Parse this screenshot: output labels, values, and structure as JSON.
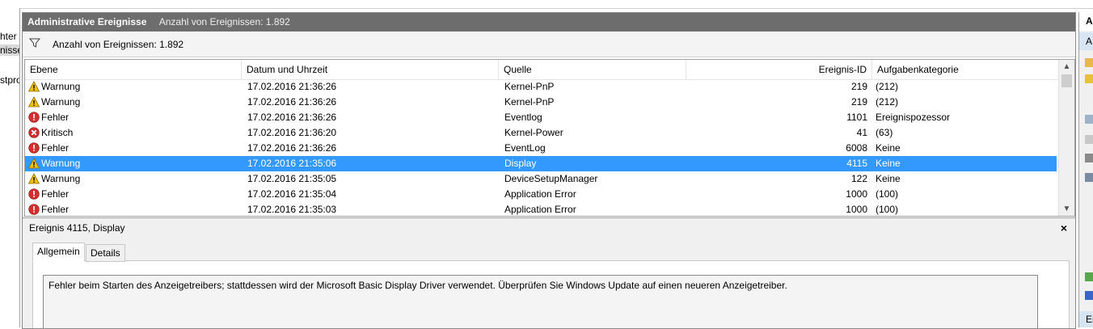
{
  "left_tree": {
    "items": [
      {
        "label": "hter"
      },
      {
        "label": "nisse"
      },
      {
        "label": "stpro"
      }
    ]
  },
  "panel": {
    "title": "Administrative Ereignisse",
    "count_text": "Anzahl von Ereignissen: 1.892",
    "filter_text": "Anzahl von Ereignissen: 1.892"
  },
  "table": {
    "columns": [
      "Ebene",
      "Datum und Uhrzeit",
      "Quelle",
      "Ereignis-ID",
      "Aufgabenkategorie"
    ],
    "rows": [
      {
        "level": "Warnung",
        "icon": "warning-icon",
        "date": "17.02.2016 21:36:26",
        "source": "Kernel-PnP",
        "id": "219",
        "category": "(212)"
      },
      {
        "level": "Warnung",
        "icon": "warning-icon",
        "date": "17.02.2016 21:36:26",
        "source": "Kernel-PnP",
        "id": "219",
        "category": "(212)"
      },
      {
        "level": "Fehler",
        "icon": "error-icon",
        "date": "17.02.2016 21:36:26",
        "source": "Eventlog",
        "id": "1101",
        "category": "Ereignispozessor"
      },
      {
        "level": "Kritisch",
        "icon": "critical-icon",
        "date": "17.02.2016 21:36:20",
        "source": "Kernel-Power",
        "id": "41",
        "category": "(63)"
      },
      {
        "level": "Fehler",
        "icon": "error-icon",
        "date": "17.02.2016 21:36:26",
        "source": "EventLog",
        "id": "6008",
        "category": "Keine"
      },
      {
        "level": "Warnung",
        "icon": "warning-icon",
        "date": "17.02.2016 21:35:06",
        "source": "Display",
        "id": "4115",
        "category": "Keine",
        "selected": true
      },
      {
        "level": "Warnung",
        "icon": "warning-icon",
        "date": "17.02.2016 21:35:05",
        "source": "DeviceSetupManager",
        "id": "122",
        "category": "Keine"
      },
      {
        "level": "Fehler",
        "icon": "error-icon",
        "date": "17.02.2016 21:35:04",
        "source": "Application Error",
        "id": "1000",
        "category": "(100)"
      },
      {
        "level": "Fehler",
        "icon": "error-icon",
        "date": "17.02.2016 21:35:03",
        "source": "Application Error",
        "id": "1000",
        "category": "(100)"
      }
    ]
  },
  "detail": {
    "header": "Ereignis 4115, Display",
    "close_label": "×",
    "tabs": [
      "Allgemein",
      "Details"
    ],
    "active_tab": "Allgemein",
    "description": "Fehler beim Starten des Anzeigetreibers; stattdessen wird der Microsoft Basic Display Driver verwendet. Überprüfen Sie Windows Update auf einen neueren Anzeigetreiber."
  },
  "actions_pane": {
    "header": "Al",
    "subheader": "A",
    "footer": "Er"
  },
  "colors": {
    "title_bar": "#6d6d6d",
    "selection": "#3399ff",
    "warning": "#f2c200",
    "error": "#d32f2f"
  }
}
